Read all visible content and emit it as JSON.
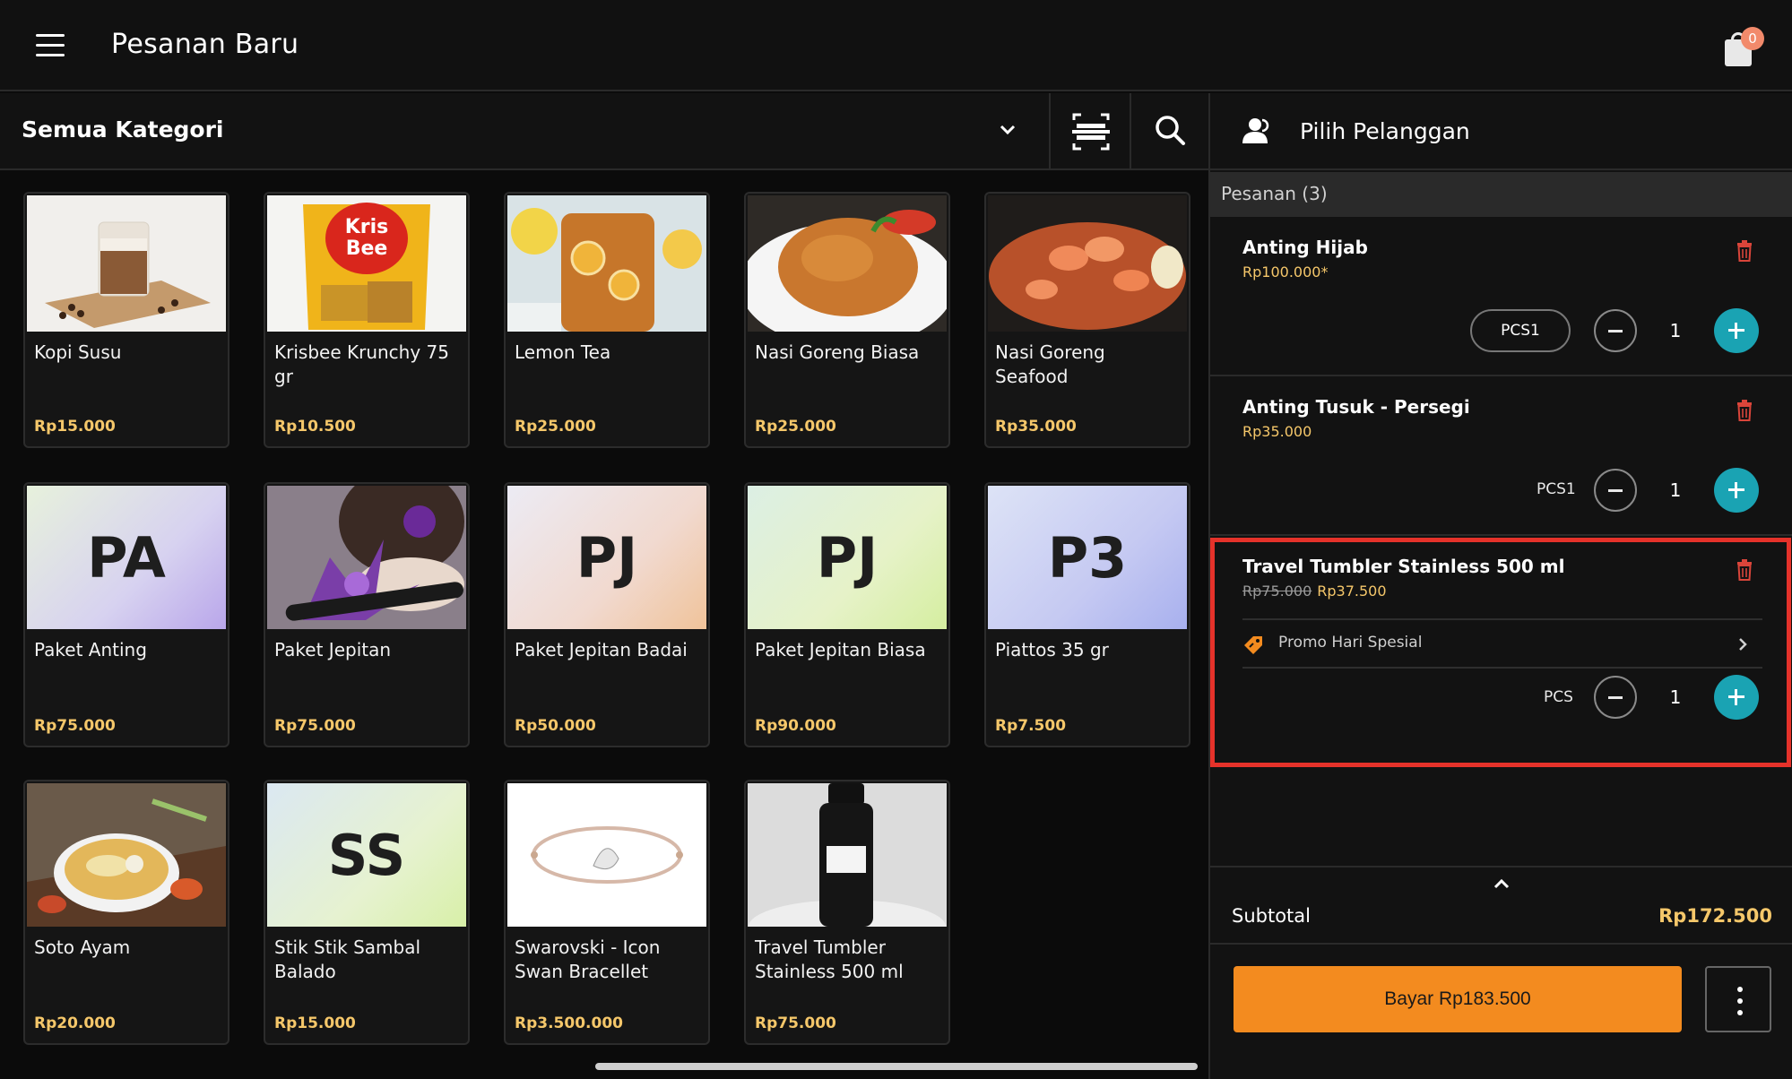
{
  "header": {
    "title": "Pesanan Baru",
    "cart_badge": "0"
  },
  "category": {
    "selected": "Semua Kategori"
  },
  "products": [
    {
      "name": "Kopi Susu",
      "price": "Rp15.000"
    },
    {
      "name": "Krisbee Krunchy 75 gr",
      "price": "Rp10.500"
    },
    {
      "name": "Lemon Tea",
      "price": "Rp25.000"
    },
    {
      "name": "Nasi Goreng Biasa",
      "price": "Rp25.000"
    },
    {
      "name": "Nasi Goreng Seafood",
      "price": "Rp35.000"
    },
    {
      "name": "Paket Anting",
      "price": "Rp75.000",
      "initials": "PA"
    },
    {
      "name": "Paket Jepitan",
      "price": "Rp75.000"
    },
    {
      "name": "Paket Jepitan Badai",
      "price": "Rp50.000",
      "initials": "PJ"
    },
    {
      "name": "Paket Jepitan Biasa",
      "price": "Rp90.000",
      "initials": "PJ"
    },
    {
      "name": "Piattos 35 gr",
      "price": "Rp7.500",
      "initials": "P3"
    },
    {
      "name": "Soto Ayam",
      "price": "Rp20.000"
    },
    {
      "name": "Stik Stik Sambal Balado",
      "price": "Rp15.000",
      "initials": "SS"
    },
    {
      "name": "Swarovski - Icon Swan Bracellet",
      "price": "Rp3.500.000"
    },
    {
      "name": "Travel Tumbler Stainless 500 ml",
      "price": "Rp75.000"
    }
  ],
  "customer": {
    "label": "Pilih Pelanggan"
  },
  "order": {
    "heading": "Pesanan (3)",
    "items": [
      {
        "name": "Anting Hijab",
        "price": "Rp100.000*",
        "unit": "PCS1",
        "qty": "1"
      },
      {
        "name": "Anting Tusuk  - Persegi",
        "price": "Rp35.000",
        "unit": "PCS1",
        "qty": "1"
      },
      {
        "name": "Travel Tumbler Stainless 500 ml",
        "old_price": "Rp75.000",
        "price": "Rp37.500",
        "promo": "Promo Hari Spesial",
        "unit": "PCS",
        "qty": "1"
      }
    ]
  },
  "summary": {
    "subtotal_label": "Subtotal",
    "subtotal_value": "Rp172.500",
    "pay_label": "Bayar Rp183.500"
  },
  "colors": {
    "accent_orange": "#f38b1f",
    "accent_teal": "#1aa3b3",
    "price_gold": "#f5c76a",
    "highlight_red": "#e5322a"
  }
}
